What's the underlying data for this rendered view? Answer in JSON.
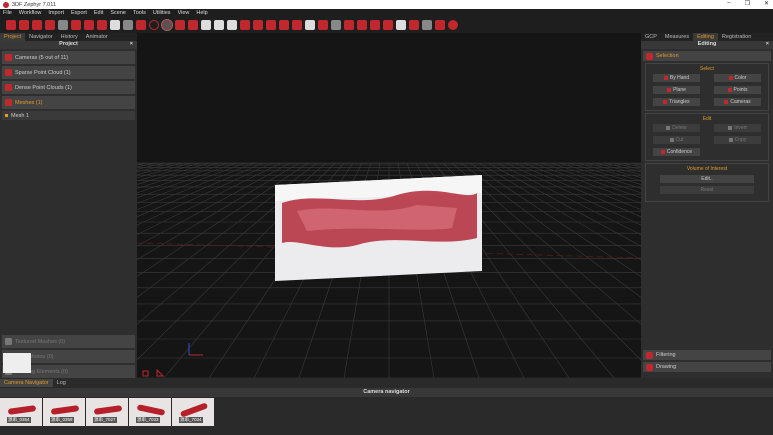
{
  "title": "3DF Zephyr 7.011",
  "window_controls": [
    "–",
    "❐",
    "✕"
  ],
  "menu": [
    "File",
    "Workflow",
    "Import",
    "Export",
    "Edit",
    "Scene",
    "Tools",
    "Utilities",
    "View",
    "Help"
  ],
  "left": {
    "tabs": [
      "Project",
      "Navigator",
      "History",
      "Animator"
    ],
    "header": "Project",
    "close": "×",
    "items": [
      "Cameras (5 out of 11)",
      "Sparse Point Cloud (1)",
      "Dense Point Clouds (1)",
      "Meshes (1)"
    ],
    "mesh": "Mesh 1",
    "bottom_items": [
      "Textured Meshes (0)",
      "Orthophotos (0)",
      "Drawing Elements (0)"
    ]
  },
  "right": {
    "tabs": [
      "GCP",
      "Measures",
      "Editing",
      "Registration"
    ],
    "header": "Editing",
    "close": "×",
    "selection": "Selection",
    "select": {
      "title": "Select",
      "buttons": [
        "By Hand",
        "Color",
        "Plane",
        "Points",
        "Triangles",
        "Cameras"
      ]
    },
    "edit": {
      "title": "Edit",
      "buttons": [
        "Delete",
        "Invert",
        "Cut",
        "Copy"
      ],
      "confidence": "Confidence"
    },
    "voi": {
      "title": "Volume of Interest",
      "edit": "Edit..",
      "reset": "Reset"
    },
    "filtering": "Filtering",
    "drawing": "Drawing"
  },
  "bottom": {
    "tabs": [
      "Camera Navigator",
      "Log"
    ],
    "header": "Camera navigator",
    "thumbs": [
      "源串_0354",
      "源串_0358",
      "源串_7027",
      "源串_7033",
      "源串_7034"
    ]
  },
  "colors": {
    "accent": "#e09a2a",
    "brand": "#c0282d"
  }
}
